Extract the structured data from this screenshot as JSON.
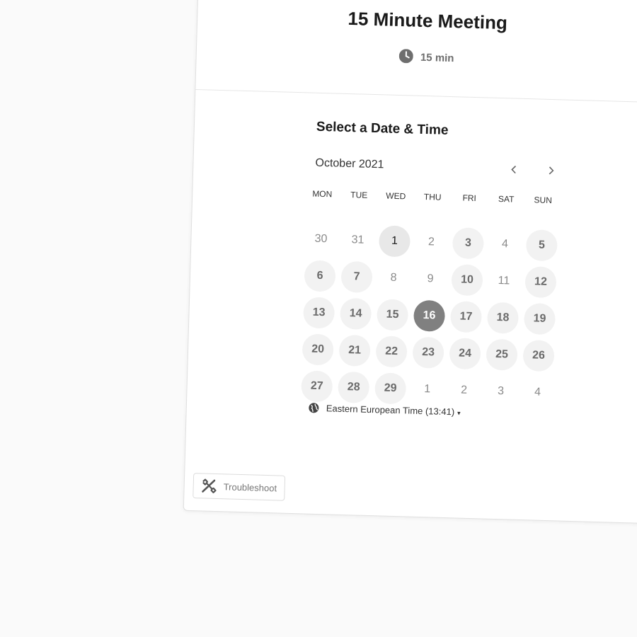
{
  "event": {
    "title": "15 Minute Meeting",
    "duration": "15 min",
    "duration_icon": "clock-icon"
  },
  "calendar": {
    "heading": "Select a Date & Time",
    "month_label": "October 2021",
    "prev_icon": "chevron-left-icon",
    "next_icon": "chevron-right-icon",
    "weekdays": [
      "MON",
      "TUE",
      "WED",
      "THU",
      "FRI",
      "SAT",
      "SUN"
    ],
    "days": [
      {
        "label": "30",
        "state": "off"
      },
      {
        "label": "31",
        "state": "off"
      },
      {
        "label": "1",
        "state": "today"
      },
      {
        "label": "2",
        "state": "off"
      },
      {
        "label": "3",
        "state": "avail"
      },
      {
        "label": "4",
        "state": "off"
      },
      {
        "label": "5",
        "state": "avail"
      },
      {
        "label": "6",
        "state": "avail"
      },
      {
        "label": "7",
        "state": "avail"
      },
      {
        "label": "8",
        "state": "off"
      },
      {
        "label": "9",
        "state": "off"
      },
      {
        "label": "10",
        "state": "avail"
      },
      {
        "label": "11",
        "state": "off"
      },
      {
        "label": "12",
        "state": "avail"
      },
      {
        "label": "13",
        "state": "avail"
      },
      {
        "label": "14",
        "state": "avail"
      },
      {
        "label": "15",
        "state": "avail"
      },
      {
        "label": "16",
        "state": "selected"
      },
      {
        "label": "17",
        "state": "avail"
      },
      {
        "label": "18",
        "state": "avail"
      },
      {
        "label": "19",
        "state": "avail"
      },
      {
        "label": "20",
        "state": "avail"
      },
      {
        "label": "21",
        "state": "avail"
      },
      {
        "label": "22",
        "state": "avail"
      },
      {
        "label": "23",
        "state": "avail"
      },
      {
        "label": "24",
        "state": "avail"
      },
      {
        "label": "25",
        "state": "avail"
      },
      {
        "label": "26",
        "state": "avail"
      },
      {
        "label": "27",
        "state": "avail"
      },
      {
        "label": "28",
        "state": "avail"
      },
      {
        "label": "29",
        "state": "avail"
      },
      {
        "label": "1",
        "state": "off"
      },
      {
        "label": "2",
        "state": "off"
      },
      {
        "label": "3",
        "state": "off"
      },
      {
        "label": "4",
        "state": "off"
      }
    ]
  },
  "timezone": {
    "label": "Eastern European Time (13:41)",
    "icon": "globe-icon",
    "caret": "▾"
  },
  "footer": {
    "troubleshoot_label": "Troubleshoot",
    "troubleshoot_icon": "wrench-icon"
  },
  "colors": {
    "selected_day": "#808080",
    "available_day_bg": "#f2f2f2",
    "page_bg": "#fafafa"
  }
}
